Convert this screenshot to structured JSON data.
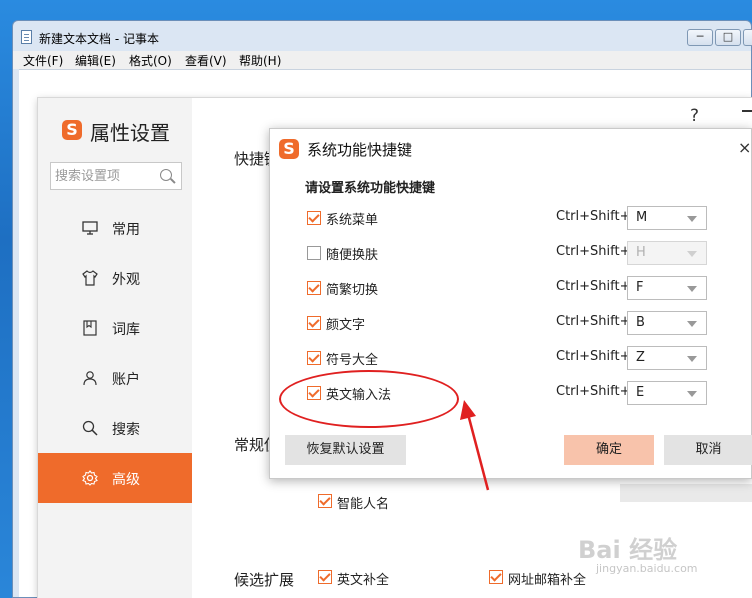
{
  "notepad": {
    "title": "新建文本文档 - 记事本",
    "menu": [
      "文件(F)",
      "编辑(E)",
      "格式(O)",
      "查看(V)",
      "帮助(H)"
    ],
    "min": "─",
    "max": "□"
  },
  "props": {
    "title": "属性设置",
    "search_placeholder": "搜索设置项",
    "help": "?",
    "sidebar": [
      {
        "label": "常用",
        "icon": "monitor-icon"
      },
      {
        "label": "外观",
        "icon": "shirt-icon"
      },
      {
        "label": "词库",
        "icon": "book-icon"
      },
      {
        "label": "账户",
        "icon": "user-icon"
      },
      {
        "label": "搜索",
        "icon": "search-icon"
      },
      {
        "label": "高级",
        "icon": "gear-icon",
        "active": true
      }
    ],
    "section_shortcut": "快捷键",
    "section_general": "常规使",
    "section_candidate": "候选扩展",
    "opt_smart_name": "智能人名",
    "opt_english_complete": "英文补全",
    "opt_url_email": "网址邮箱补全"
  },
  "dialog": {
    "title": "系统功能快捷键",
    "close": "×",
    "heading": "请设置系统功能快捷键",
    "rows": [
      {
        "name": "系统菜单",
        "checked": true,
        "modifier": "Ctrl+Shift+",
        "key": "M",
        "disabled": false
      },
      {
        "name": "随便换肤",
        "checked": false,
        "modifier": "Ctrl+Shift+",
        "key": "H",
        "disabled": true
      },
      {
        "name": "简繁切换",
        "checked": true,
        "modifier": "Ctrl+Shift+",
        "key": "F",
        "disabled": false
      },
      {
        "name": "颜文字",
        "checked": true,
        "modifier": "Ctrl+Shift+",
        "key": "B",
        "disabled": false
      },
      {
        "name": "符号大全",
        "checked": true,
        "modifier": "Ctrl+Shift+",
        "key": "Z",
        "disabled": false
      },
      {
        "name": "英文输入法",
        "checked": true,
        "modifier": "Ctrl+Shift+",
        "key": "E",
        "disabled": false
      }
    ],
    "restore_label": "恢复默认设置",
    "ok_label": "确定",
    "cancel_label": "取消"
  },
  "watermark": {
    "text": "Bai 经验",
    "sub": "jingyan.baidu.com"
  },
  "colors": {
    "accent": "#ef6b2b",
    "annotation": "#e02020"
  }
}
